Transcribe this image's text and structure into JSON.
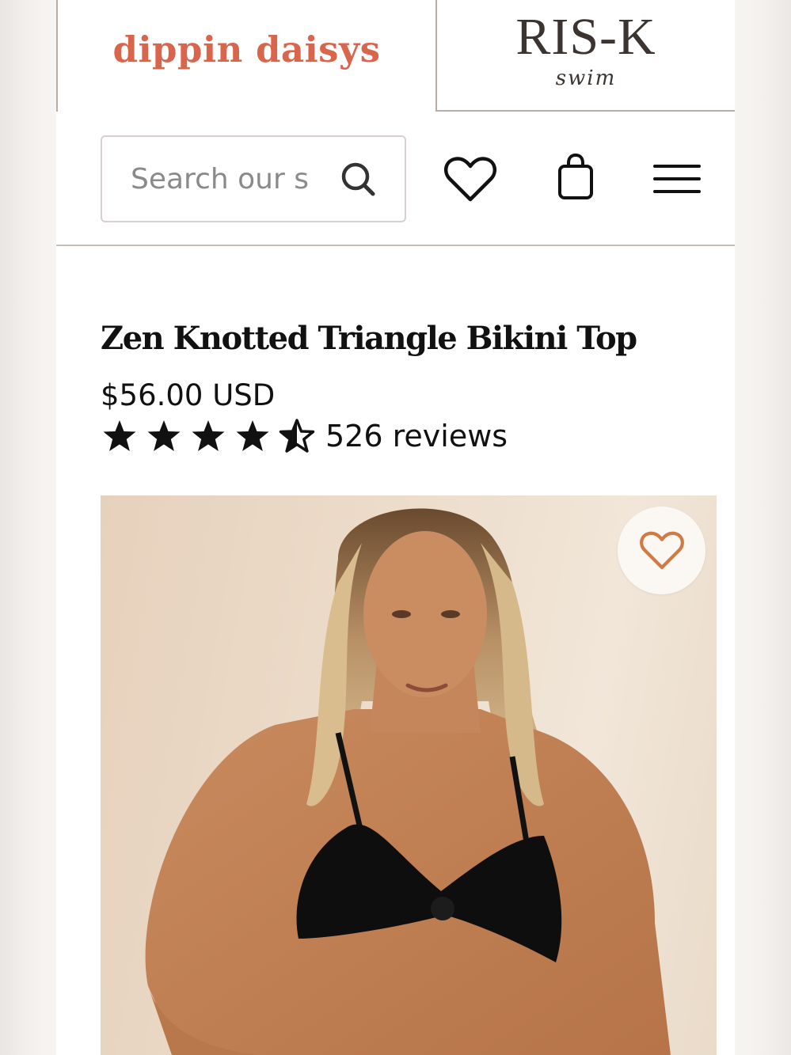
{
  "brands": {
    "primary": "dippin daisys",
    "secondary": "RIS-K",
    "secondary_tagline": "swim"
  },
  "header": {
    "search_placeholder": "Search our s",
    "icons": [
      "search-icon",
      "heart-icon",
      "shopping-bag-icon",
      "hamburger-menu-icon"
    ]
  },
  "product": {
    "title": "Zen Knotted Triangle Bikini Top",
    "price": "$56.00 USD",
    "rating": 4.5,
    "rating_max": 5,
    "review_count": "526 reviews"
  },
  "image": {
    "description_icon": "product-photo",
    "favorite_icon": "heart-outline-icon"
  },
  "colors": {
    "brand_accent": "#d9654c",
    "risk_logo": "#3b3430",
    "favorite_heart": "#d07a45",
    "text": "#111111",
    "divider": "#c8bdb6"
  }
}
